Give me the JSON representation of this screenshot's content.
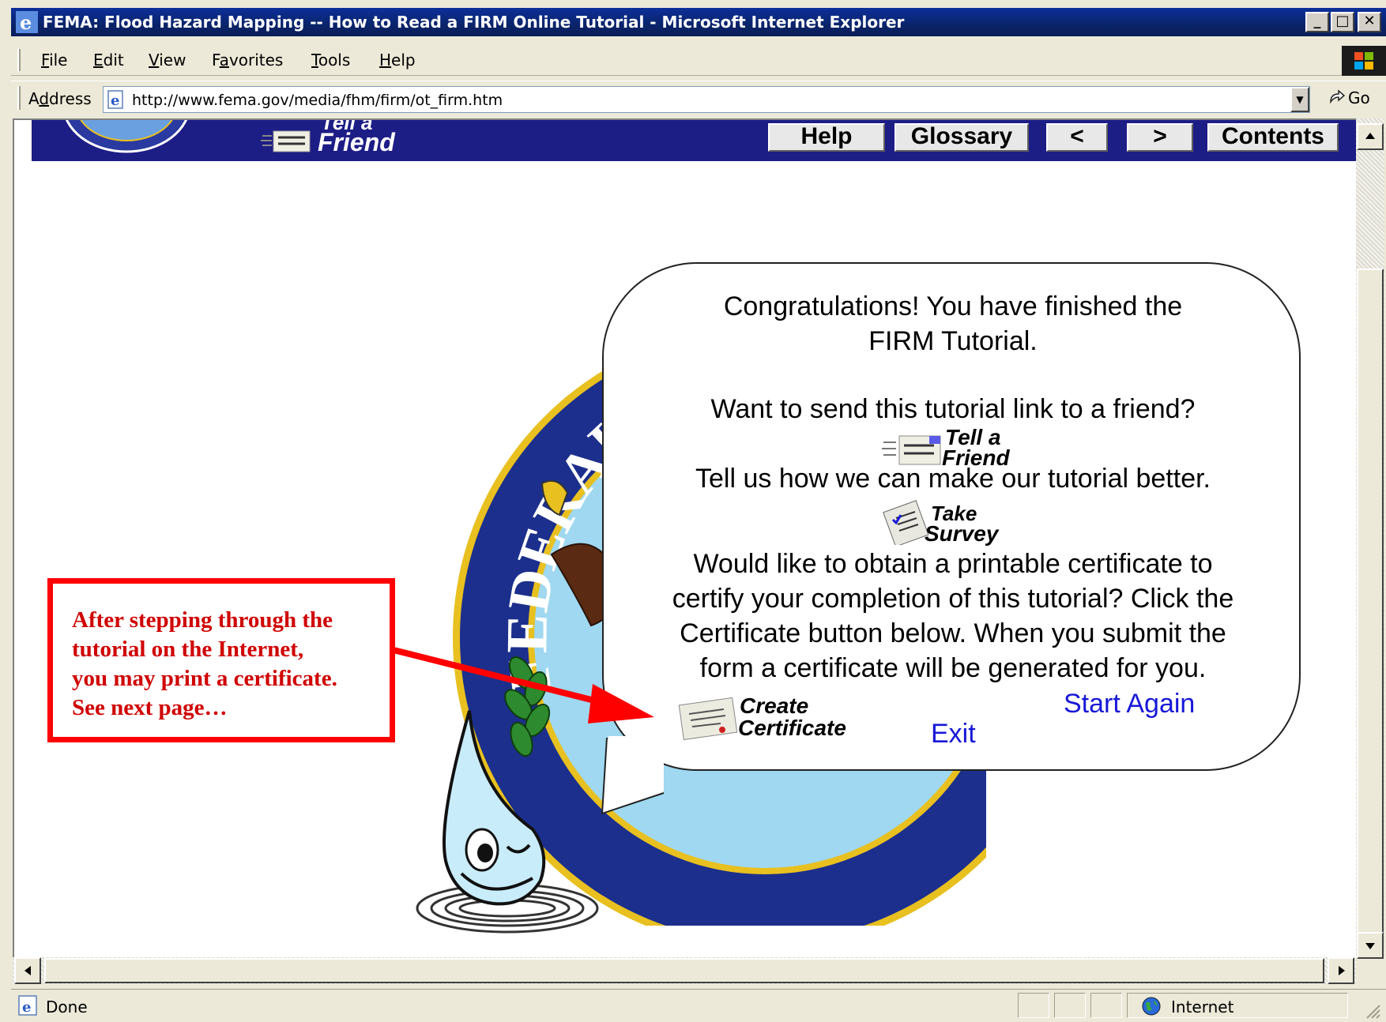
{
  "window": {
    "title": "FEMA: Flood Hazard Mapping -- How to Read a FIRM Online Tutorial - Microsoft Internet Explorer",
    "controls": [
      "_",
      "□",
      "✕"
    ]
  },
  "menu": {
    "items": [
      {
        "pre": "",
        "ul": "F",
        "post": "ile"
      },
      {
        "pre": "",
        "ul": "E",
        "post": "dit"
      },
      {
        "pre": "",
        "ul": "V",
        "post": "iew"
      },
      {
        "pre": "F",
        "ul": "a",
        "post": "vorites"
      },
      {
        "pre": "",
        "ul": "T",
        "post": "ools"
      },
      {
        "pre": "",
        "ul": "H",
        "post": "elp"
      }
    ]
  },
  "address": {
    "label_pre": "A",
    "label_ul": "d",
    "label_post": "dress",
    "url": "http://www.fema.gov/media/fhm/firm/ot_firm.htm",
    "go_label": "Go"
  },
  "site_nav": {
    "tell_friend": "Friend",
    "tell_friend_top": "Tell a",
    "help": "Help",
    "glossary": "Glossary",
    "prev": "<",
    "next": ">",
    "contents": "Contents"
  },
  "seal": {
    "ring_text": "FEDERAL EMERGENCY"
  },
  "bubble": {
    "congrats_line1": "Congratulations! You have finished the",
    "congrats_line2": "FIRM Tutorial.",
    "friend_prompt": "Want to send this tutorial link to a friend?",
    "friend_btn_line1": "Tell a",
    "friend_btn_line2": "Friend",
    "survey_prompt": "Tell us how we can make our tutorial better.",
    "survey_btn_line1": "Take",
    "survey_btn_line2": "Survey",
    "cert_line1": "Would like to obtain a printable certificate to",
    "cert_line2": "certify your completion of this tutorial? Click the",
    "cert_line3": "Certificate button below. When you submit the",
    "cert_line4": "form a certificate will be generated for you.",
    "cert_btn_line1": "Create",
    "cert_btn_line2": "Certificate",
    "start_again": "Start Again",
    "exit": "Exit"
  },
  "callout": {
    "line1": "After stepping through the",
    "line2": "tutorial on the Internet,",
    "line3": "you may print a certificate.",
    "line4": "See next page…"
  },
  "status": {
    "text": "Done",
    "zone": "Internet"
  },
  "colors": {
    "title_bar": "#0a246a",
    "site_bar": "#1d1d86",
    "link": "#1818d8",
    "callout": "#ff0000",
    "seal_blue": "#1c2f8c",
    "seal_gold": "#e8c020"
  }
}
